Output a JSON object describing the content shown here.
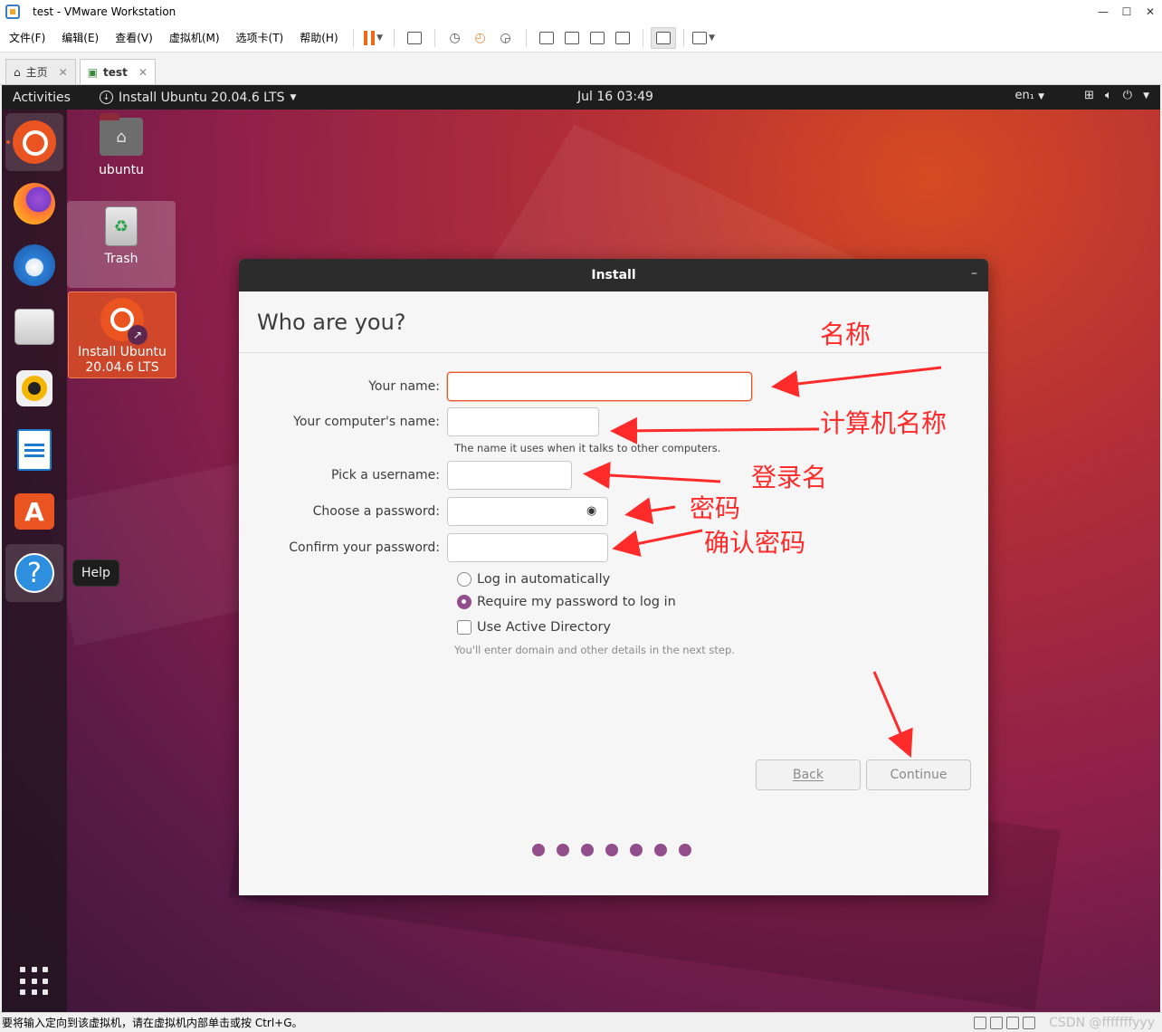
{
  "vm": {
    "title": "test - VMware Workstation",
    "menu": [
      "文件(F)",
      "编辑(E)",
      "查看(V)",
      "虚拟机(M)",
      "选项卡(T)",
      "帮助(H)"
    ],
    "tabs": [
      {
        "label": "主页"
      },
      {
        "label": "test"
      }
    ],
    "status_text": "要将输入定向到该虚拟机，请在虚拟机内部单击或按 Ctrl+G。",
    "watermark": "CSDN @fffffffyyy"
  },
  "ubuntu": {
    "activities": "Activities",
    "app_menu": "Install Ubuntu 20.04.6 LTS",
    "clock": "Jul 16  03:49",
    "lang": "en₁",
    "help_tooltip": "Help",
    "desktop": {
      "home_label": "ubuntu",
      "trash_label": "Trash",
      "installer_label_1": "Install Ubuntu",
      "installer_label_2": "20.04.6 LTS"
    }
  },
  "dialog": {
    "header": "Install",
    "title": "Who are you?",
    "fields": {
      "name_label": "Your name:",
      "name_value": "",
      "computer_label": "Your computer's name:",
      "computer_value": "",
      "computer_hint": "The name it uses when it talks to other computers.",
      "username_label": "Pick a username:",
      "username_value": "",
      "password_label": "Choose a password:",
      "password_value": "",
      "confirm_label": "Confirm your password:",
      "confirm_value": ""
    },
    "options": {
      "auto_login": "Log in automatically",
      "require_password": "Require my password to log in",
      "active_directory": "Use Active Directory",
      "ad_hint": "You'll enter domain and other details in the next step."
    },
    "buttons": {
      "back": "Back",
      "continue": "Continue"
    },
    "progress_steps": 7
  },
  "annotations": {
    "name": "名称",
    "computer_name": "计算机名称",
    "login_name": "登录名",
    "password": "密码",
    "confirm_password": "确认密码"
  },
  "colors": {
    "ubuntu_orange": "#e95420",
    "aubergine": "#924d8b",
    "annotation_red": "#ff2a2a",
    "topbar": "#1d1d1d"
  }
}
